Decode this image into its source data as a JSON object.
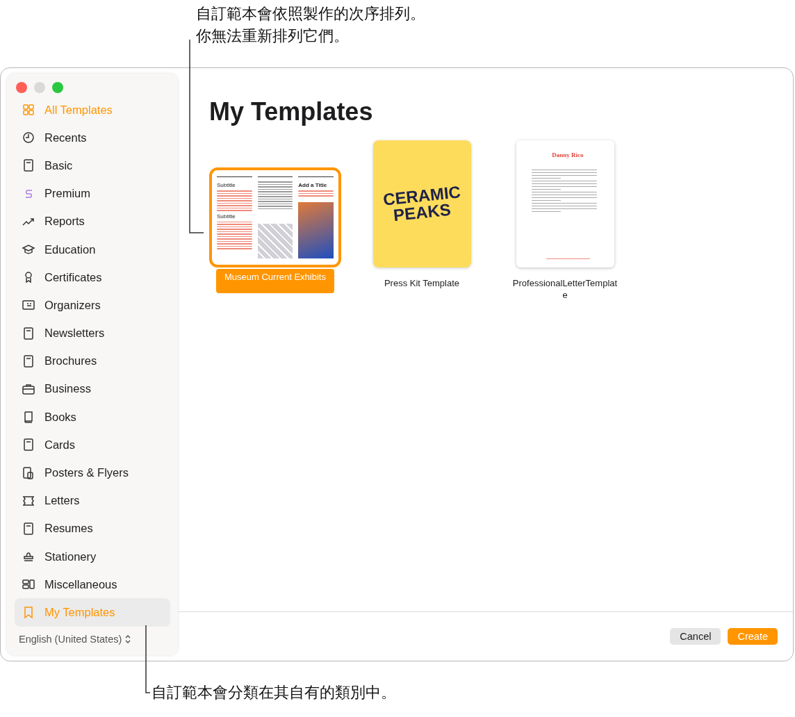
{
  "callouts": [
    {
      "lines": [
        "自訂範本會依照製作的次序排列。",
        "你無法重新排列它們。"
      ]
    },
    {
      "lines": [
        "自訂範本會分類在其自有的類別中。"
      ]
    }
  ],
  "sidebar": {
    "items": [
      {
        "label": "All Templates",
        "highlighted": true,
        "selected": false
      },
      {
        "label": "Recents",
        "highlighted": false,
        "selected": false
      },
      {
        "label": "Basic",
        "highlighted": false,
        "selected": false
      },
      {
        "label": "Premium",
        "highlighted": false,
        "selected": false
      },
      {
        "label": "Reports",
        "highlighted": false,
        "selected": false
      },
      {
        "label": "Education",
        "highlighted": false,
        "selected": false
      },
      {
        "label": "Certificates",
        "highlighted": false,
        "selected": false
      },
      {
        "label": "Organizers",
        "highlighted": false,
        "selected": false
      },
      {
        "label": "Newsletters",
        "highlighted": false,
        "selected": false
      },
      {
        "label": "Brochures",
        "highlighted": false,
        "selected": false
      },
      {
        "label": "Business",
        "highlighted": false,
        "selected": false
      },
      {
        "label": "Books",
        "highlighted": false,
        "selected": false
      },
      {
        "label": "Cards",
        "highlighted": false,
        "selected": false
      },
      {
        "label": "Posters & Flyers",
        "highlighted": false,
        "selected": false
      },
      {
        "label": "Letters",
        "highlighted": false,
        "selected": false
      },
      {
        "label": "Resumes",
        "highlighted": false,
        "selected": false
      },
      {
        "label": "Stationery",
        "highlighted": false,
        "selected": false
      },
      {
        "label": "Miscellaneous",
        "highlighted": false,
        "selected": false
      },
      {
        "label": "My Templates",
        "highlighted": true,
        "selected": true
      }
    ],
    "language": "English (United States)"
  },
  "main": {
    "title": "My Templates",
    "templates": [
      {
        "name": "Museum Current Exhibits",
        "kind": "brochure",
        "selected": true,
        "headings": [
          "Subtitle",
          "Subtitle",
          "Add a Title"
        ]
      },
      {
        "name": "Press Kit Template",
        "kind": "poster",
        "selected": false,
        "headings": [
          "CERAMIC",
          "PEAKS"
        ]
      },
      {
        "name": "ProfessionalLetterTemplate",
        "kind": "letter",
        "selected": false,
        "headings": [
          "Danny Rico"
        ]
      }
    ]
  },
  "buttons": [
    {
      "label": "Cancel",
      "kind": "secondary"
    },
    {
      "label": "Create",
      "kind": "primary"
    }
  ]
}
